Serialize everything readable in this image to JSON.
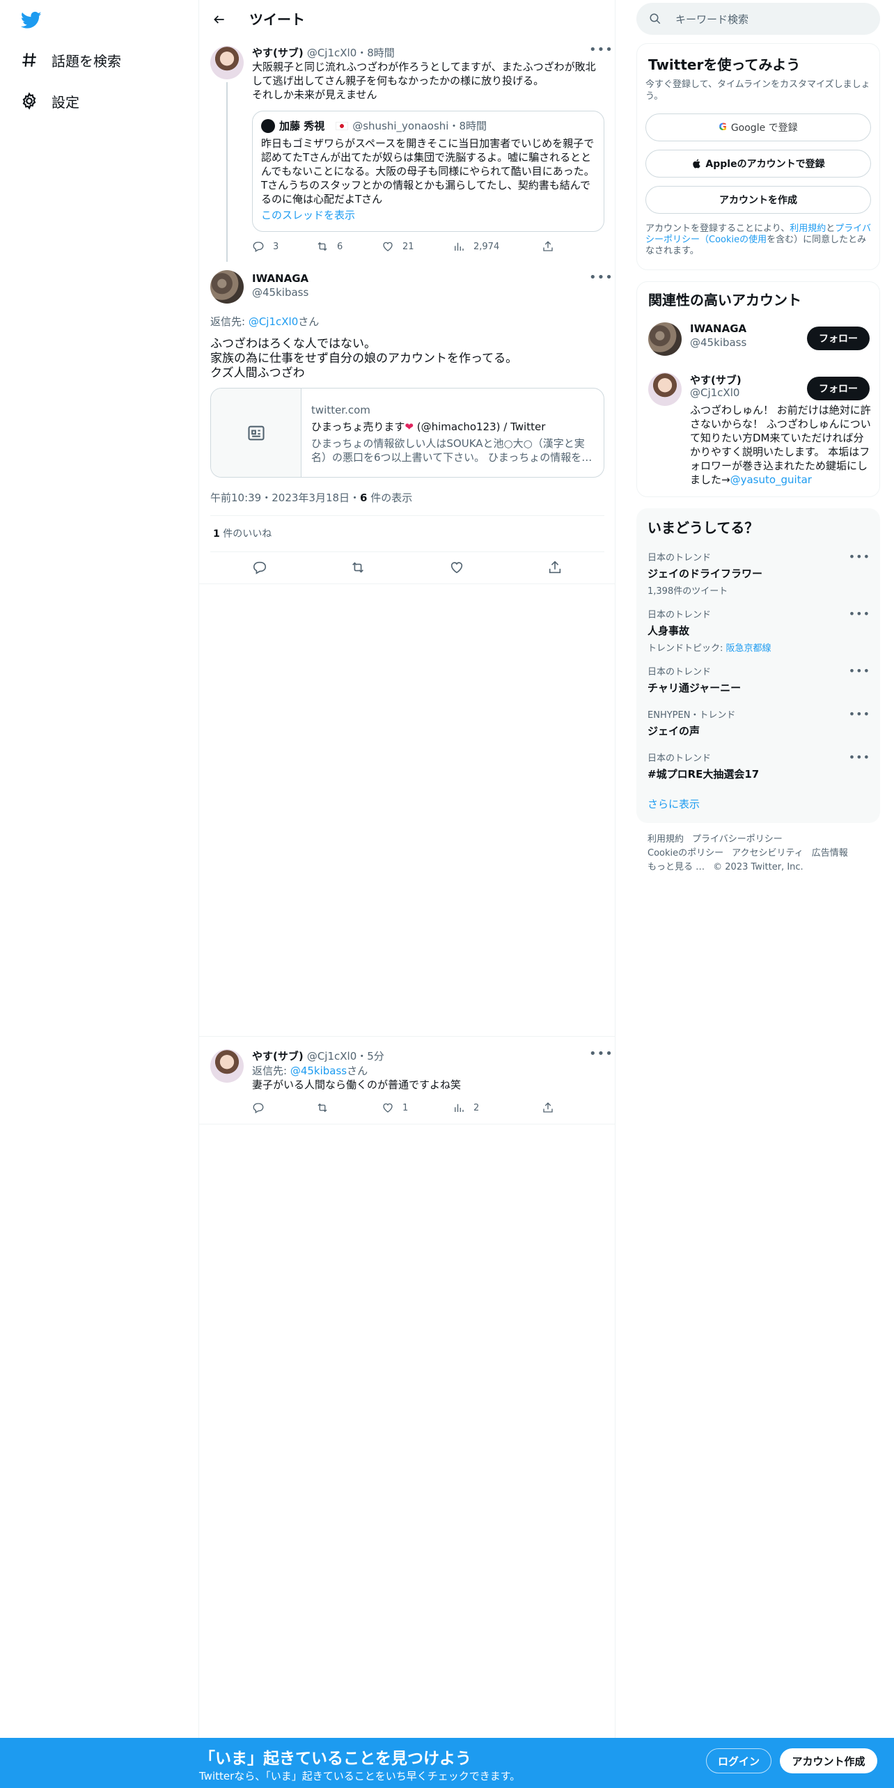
{
  "nav": {
    "explore_label": "話題を検索",
    "settings_label": "設定"
  },
  "header": {
    "title": "ツイート"
  },
  "parent_tweet": {
    "name": "やす(サブ)",
    "handle": "@Cj1cXl0",
    "time": "・8時間",
    "text": "大阪親子と同じ流れふつざわが作ろうとしてますが、またふつざわが敗北して逃げ出してさん親子を何もなかったかの様に放り投げる。\nそれしか未来が見えません",
    "quote": {
      "name": "加藤 秀視",
      "handle": "@shushi_yonaoshi",
      "time": "・8時間",
      "text": "昨日もゴミザワらがスペースを開きそこに当日加害者でいじめを親子で認めてたTさんが出てたが奴らは集団で洗脳するよ。嘘に騙されるととんでもないことになる。大阪の母子も同様にやられて酷い目にあった。Tさんうちのスタッフとかの情報とかも漏らしてたし、契約書も結んでるのに俺は心配だよTさん",
      "show_thread": "このスレッドを表示"
    },
    "replies": "3",
    "retweets": "6",
    "likes": "21",
    "views": "2,974"
  },
  "main_tweet": {
    "name": "IWANAGA",
    "handle": "@45kibass",
    "reply_prefix": "返信先: ",
    "reply_to": "@Cj1cXl0",
    "reply_suffix": "さん",
    "text": "ふつざわはろくな人ではない。\n家族の為に仕事をせず自分の娘のアカウントを作ってる。\nクズ人間ふつざわ",
    "link_card": {
      "domain": "twitter.com",
      "title_pre": "ひまっちょ売ります",
      "title_post": " (@himacho123) / Twitter",
      "description": "ひまっちょの情報欲しい人はSOUKAと池○大○（漢字と実名）の悪口を6つ以上書いて下さい。 ひまっちょの情報を…"
    },
    "timestamp": "午前10:39・2023年3月18日・",
    "views_count": "6",
    "views_label": " 件の表示",
    "likes_count": "1",
    "likes_label": " 件のいいね"
  },
  "reply_tweet": {
    "name": "やす(サブ)",
    "handle": "@Cj1cXl0",
    "time": "・5分",
    "reply_prefix": "返信先: ",
    "reply_to": "@45kibass",
    "reply_suffix": "さん",
    "text": "妻子がいる人間なら働くのが普通ですよね笑",
    "likes": "1",
    "views": "2"
  },
  "search": {
    "placeholder": "キーワード検索"
  },
  "signup_panel": {
    "title": "Twitterを使ってみよう",
    "subtitle": "今すぐ登録して、タイムラインをカスタマイズしましょう。",
    "google_btn": "Google で登録",
    "apple_btn": "Appleのアカウントで登録",
    "create_btn": "アカウントを作成",
    "legal_pre": "アカウントを登録することにより、",
    "legal_terms": "利用規約",
    "legal_and": "と",
    "legal_privacy": "プライバシーポリシー（Cookieの使用",
    "legal_post": "を含む）に同意したとみなされます。"
  },
  "relevant_panel": {
    "title": "関連性の高いアカウント",
    "accounts": [
      {
        "name": "IWANAGA",
        "handle": "@45kibass",
        "follow": "フォロー"
      },
      {
        "name": "やす(サブ)",
        "handle": "@Cj1cXl0",
        "follow": "フォロー",
        "bio": "ふつざわしゅん！ お前だけは絶対に許さないからな！ ふつざわしゅんについて知りたい方DM来ていただければ分かりやすく説明いたします。 本垢はフォロワーが巻き込まれたため鍵垢にしました→",
        "bio_link": "@yasuto_guitar"
      }
    ]
  },
  "trends_panel": {
    "title": "いまどうしてる？",
    "trends": [
      {
        "category": "日本のトレンド",
        "name": "ジェイのドライフラワー",
        "sub": "1,398件のツイート"
      },
      {
        "category": "日本のトレンド",
        "name": "人身事故",
        "sub_prefix": "トレンドトピック: ",
        "sub_link": "阪急京都線"
      },
      {
        "category": "日本のトレンド",
        "name": "チャリ通ジャーニー"
      },
      {
        "category": "ENHYPEN・トレンド",
        "name": "ジェイの声"
      },
      {
        "category": "日本のトレンド",
        "name": "#城プロRE大抽選会17"
      }
    ],
    "show_more": "さらに表示"
  },
  "footer": {
    "terms": "利用規約",
    "privacy": "プライバシーポリシー",
    "cookie": "Cookieのポリシー",
    "accessibility": "アクセシビリティ",
    "ads": "広告情報",
    "more": "もっと見る …",
    "copyright": "© 2023 Twitter, Inc."
  },
  "bottom_bar": {
    "title": "「いま」起きていることを見つけよう",
    "subtitle": "Twitterなら、「いま」起きていることをいち早くチェックできます。",
    "login": "ログイン",
    "signup": "アカウント作成"
  },
  "colors": {
    "accent": "#1d9bf0",
    "text": "#0f1419",
    "muted": "#536471",
    "heart": "#e0245e"
  }
}
